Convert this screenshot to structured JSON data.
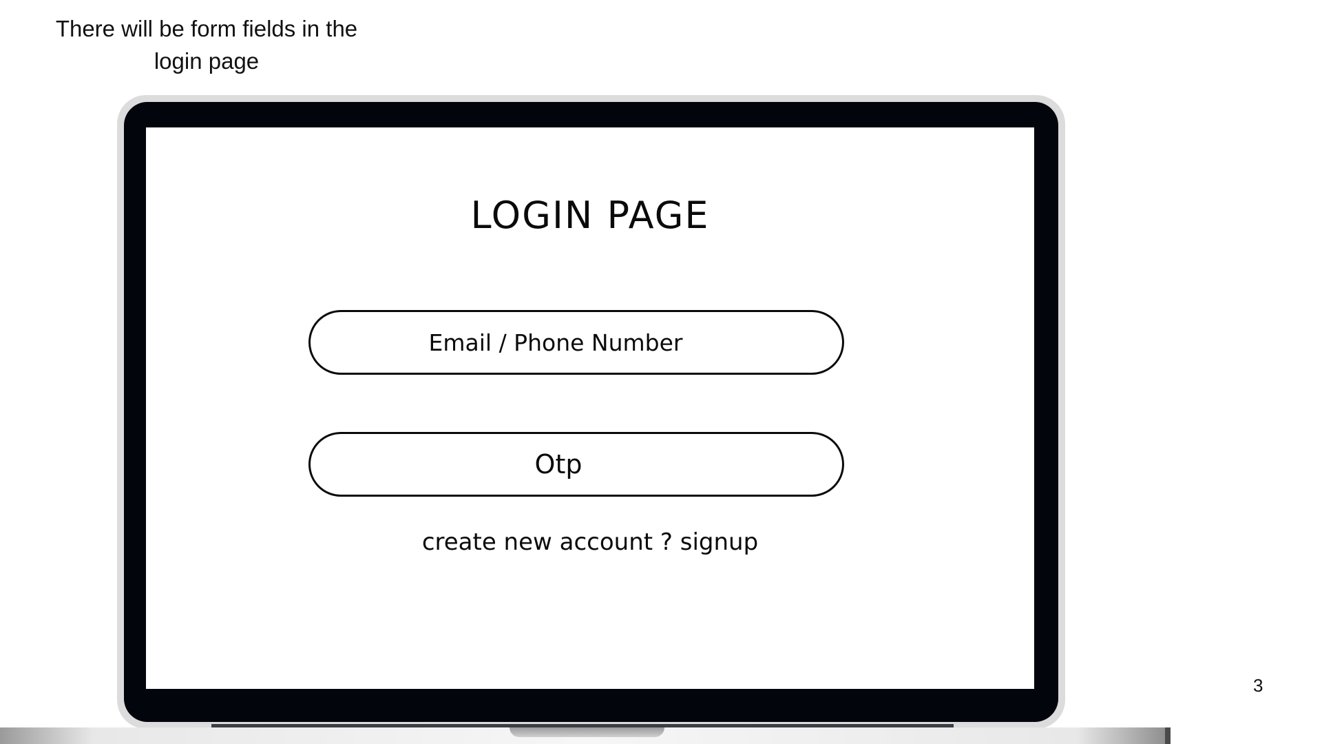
{
  "caption": {
    "line1": "There will be form fields in the",
    "line2": "login page"
  },
  "screen": {
    "title": "LOGIN PAGE",
    "email_field": {
      "placeholder": "Email / Phone Number"
    },
    "otp_field": {
      "placeholder": "Otp"
    },
    "signup_text": "create new account ? signup"
  },
  "page_number": "3",
  "colors": {
    "bezel": "#03050d",
    "screen": "#ffffff",
    "text": "#0a0a0a"
  }
}
